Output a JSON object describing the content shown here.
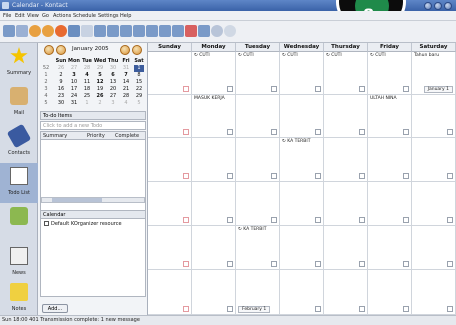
{
  "window": {
    "title": "Calendar - Kontact"
  },
  "menu": [
    "File",
    "Edit",
    "View",
    "Go",
    "Actions",
    "Schedule",
    "Settings",
    "Help"
  ],
  "overlay_badge": "8",
  "sidebar": [
    {
      "label": "Summary",
      "icon": "star-icon"
    },
    {
      "label": "Mail",
      "icon": "mail-icon"
    },
    {
      "label": "Contacts",
      "icon": "contacts-icon"
    },
    {
      "label": "Todo List",
      "icon": "todo-icon"
    },
    {
      "label": "",
      "icon": "calendar-icon"
    },
    {
      "label": "News",
      "icon": "news-icon"
    },
    {
      "label": "Notes",
      "icon": "notes-icon"
    }
  ],
  "mini_calendar": {
    "month_label": "January 2005",
    "headers": [
      "Sun",
      "Mon",
      "Tue",
      "Wed",
      "Thu",
      "Fri",
      "Sat"
    ],
    "weeks": [
      {
        "wk": "52",
        "days": [
          "26",
          "27",
          "28",
          "29",
          "30",
          "31",
          "1"
        ]
      },
      {
        "wk": "1",
        "days": [
          "2",
          "3",
          "4",
          "5",
          "6",
          "7",
          "8"
        ]
      },
      {
        "wk": "2",
        "days": [
          "9",
          "10",
          "11",
          "12",
          "13",
          "14",
          "15"
        ]
      },
      {
        "wk": "3",
        "days": [
          "16",
          "17",
          "18",
          "19",
          "20",
          "21",
          "22"
        ]
      },
      {
        "wk": "4",
        "days": [
          "23",
          "24",
          "25",
          "26",
          "27",
          "28",
          "29"
        ]
      },
      {
        "wk": "5",
        "days": [
          "30",
          "31",
          "1",
          "2",
          "3",
          "4",
          "5"
        ]
      }
    ]
  },
  "todo": {
    "header": "To-do Items",
    "placeholder": "Click to add a new Todo",
    "columns": [
      "Summary",
      "Priority",
      "Complete"
    ]
  },
  "calendars": {
    "header": "Calendar",
    "items": [
      "Default KOrganizer resource"
    ],
    "add_button": "Add..."
  },
  "month_view": {
    "days": [
      "Sunday",
      "Monday",
      "Tuesday",
      "Wednesday",
      "Thursday",
      "Friday",
      "Saturday"
    ],
    "events": {
      "cuti": "CUTI",
      "tahun_baru": "Tahun baru",
      "january": "January 1",
      "masuk_kerja": "MASUK KERJA",
      "ultah_nina": "ULTAH NINA",
      "ka_terbit": "KA TERBIT",
      "february": "February 1"
    }
  },
  "status": {
    "text": "Sun 18:00 401 Transmission complete: 1 new message"
  }
}
